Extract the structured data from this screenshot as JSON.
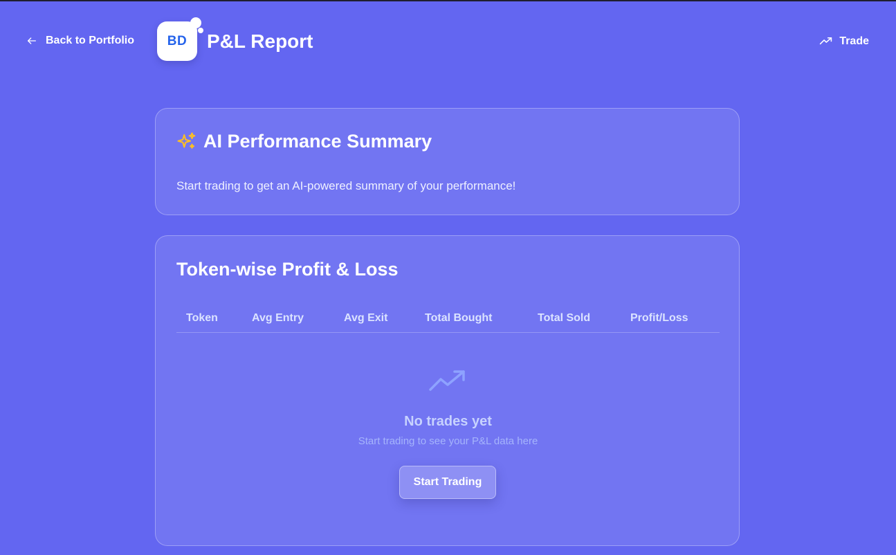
{
  "header": {
    "back_label": "Back to Portfolio",
    "logo_text": "BD",
    "title": "P&L Report",
    "trade_label": "Trade"
  },
  "ai_summary": {
    "title": "AI Performance Summary",
    "description": "Start trading to get an AI-powered summary of your performance!",
    "icon": "sparkles-icon",
    "icon_color": "#fbbf24"
  },
  "pnl": {
    "title": "Token-wise Profit & Loss",
    "columns": [
      "Token",
      "Avg Entry",
      "Avg Exit",
      "Total Bought",
      "Total Sold",
      "Profit/Loss"
    ],
    "empty": {
      "icon": "trending-up-icon",
      "title": "No trades yet",
      "subtitle": "Start trading to see your P&L data here",
      "button_label": "Start Trading"
    }
  },
  "colors": {
    "background": "#6366f1",
    "logo_text": "#2563eb",
    "accent": "#fbbf24"
  }
}
